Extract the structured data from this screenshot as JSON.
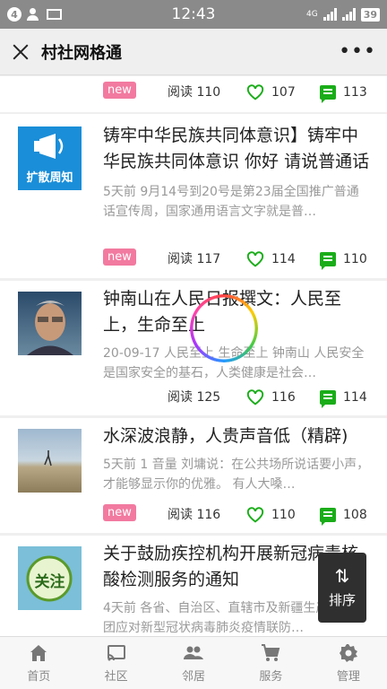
{
  "status": {
    "notif_count": "4",
    "time": "12:43",
    "network": "4G",
    "battery": "39"
  },
  "appbar": {
    "title": "村社网格通",
    "more": "•••"
  },
  "cards": [
    {
      "badge": "new",
      "reads": "阅读 110",
      "likes": "107",
      "comments": "113"
    },
    {
      "thumb_text": "扩散周知",
      "title": "铸牢中华民族共同体意识】铸牢中华民族共同体意识 你好 请说普通话",
      "meta": "5天前    9月14号到20号是第23届全国推广普通话宣传周，国家通用语言文字就是普…",
      "badge": "new",
      "reads": "阅读 117",
      "likes": "114",
      "comments": "110"
    },
    {
      "title": "钟南山在人民日报撰文：人民至上，生命至上",
      "meta": "20-09-17    人民至上 生命至上 钟南山 人民安全是国家安全的基石，人类健康是社会…",
      "reads": "阅读 125",
      "likes": "116",
      "comments": "114"
    },
    {
      "title": "水深波浪静，人贵声音低（精辟)",
      "meta": "5天前    1 音量 刘墉说：在公共场所说话要小声，才能够显示你的优雅。 有人大嗓…",
      "badge": "new",
      "reads": "阅读 116",
      "likes": "110",
      "comments": "108"
    },
    {
      "thumb_text": "关注",
      "title": "关于鼓励疾控机构开展新冠病毒核酸检测服务的通知",
      "meta": "4天前    各省、自治区、直辖市及新疆生产建设兵团应对新型冠状病毒肺炎疫情联防…"
    }
  ],
  "sort_button": {
    "icon": "⇅",
    "label": "排序"
  },
  "nav": [
    {
      "label": "首页",
      "icon": "home-icon"
    },
    {
      "label": "社区",
      "icon": "cast-icon"
    },
    {
      "label": "邻居",
      "icon": "people-icon"
    },
    {
      "label": "服务",
      "icon": "cart-icon"
    },
    {
      "label": "管理",
      "icon": "gear-icon"
    }
  ],
  "colors": {
    "accent_green": "#1aad19",
    "badge_pink": "#f27aa0",
    "status_bar": "#8a8a8a"
  }
}
